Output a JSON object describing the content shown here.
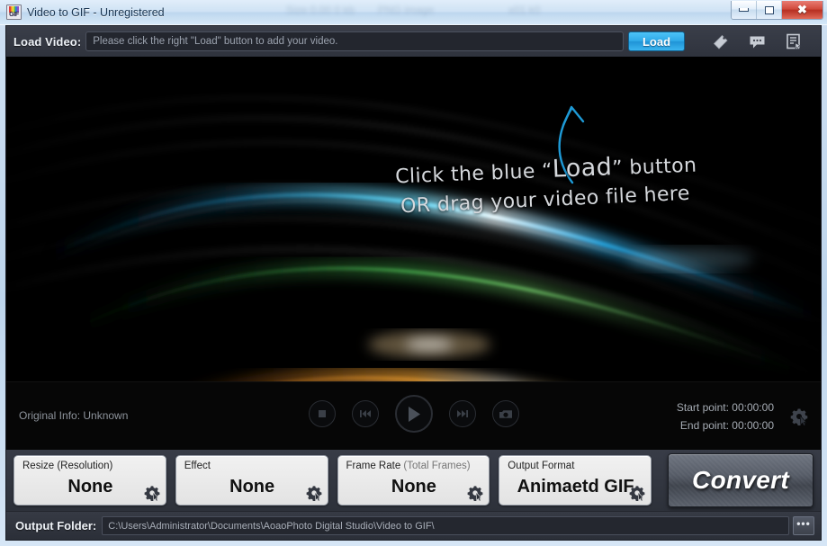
{
  "window": {
    "title": "Video to GIF - Unregistered",
    "app_icon": "gif-app-icon",
    "ghost_text_1": "Size 0.00 0 kb",
    "ghost_text_2": "PNG image",
    "ghost_text_3": "x01 k0",
    "minimize_label": "–",
    "maximize_label": "□",
    "close_label": "✕"
  },
  "load_bar": {
    "label": "Load Video:",
    "input_placeholder": "Please click the right \"Load\" button to add your video.",
    "input_value": "",
    "load_button": "Load",
    "icons": [
      "tag-icon",
      "comment-icon",
      "register-icon"
    ]
  },
  "preview": {
    "hint_line1_a": "Click the blue “",
    "hint_line1_big": "Load",
    "hint_line1_b": "” button",
    "hint_line2": "OR drag your video file here",
    "arrow": "curved-up-arrow",
    "arrow_color": "#1e9ad6"
  },
  "controls": {
    "original_info": "Original Info: Unknown",
    "transport": [
      {
        "name": "stop-button",
        "glyph": "stop"
      },
      {
        "name": "previous-button",
        "glyph": "prev"
      },
      {
        "name": "play-button",
        "glyph": "play"
      },
      {
        "name": "next-button",
        "glyph": "next"
      },
      {
        "name": "snapshot-button",
        "glyph": "camera"
      }
    ],
    "start_point_label": "Start point:",
    "start_point_value": "00:00:00",
    "end_point_label": "End point:",
    "end_point_value": "00:00:00",
    "time_settings_icon": "gear-cursor-icon"
  },
  "options": [
    {
      "name": "resize-option",
      "caption": "Resize (Resolution)",
      "caption_dim": "",
      "value": "None"
    },
    {
      "name": "effect-option",
      "caption": "Effect",
      "caption_dim": "",
      "value": "None"
    },
    {
      "name": "frame-rate-option",
      "caption": "Frame Rate ",
      "caption_dim": "(Total Frames)",
      "value": "None"
    },
    {
      "name": "output-format-option",
      "caption": "Output Format",
      "caption_dim": "",
      "value": "Animaetd GIF"
    }
  ],
  "convert_button": "Convert",
  "output_folder": {
    "label": "Output Folder:",
    "path": "C:\\Users\\Administrator\\Documents\\AoaoPhoto Digital Studio\\Video to GIF\\",
    "browse_label": "•••"
  },
  "colors": {
    "accent_blue": "#2fa9e8",
    "chrome_dark": "#31353f",
    "preview_black": "#000000",
    "panel_light": "#e8e8e8"
  }
}
